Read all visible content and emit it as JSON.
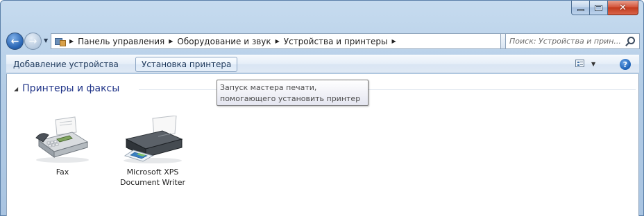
{
  "window": {
    "minimize_icon": "minimize-icon",
    "maximize_icon": "maximize-icon",
    "close_icon": "close-icon",
    "close_glyph": "✕"
  },
  "navigation": {
    "back_icon": "back-arrow-icon",
    "forward_icon": "forward-arrow-icon",
    "back_glyph": "←",
    "forward_glyph": "→",
    "recent_glyph": "▼",
    "breadcrumb": [
      "Панель управления",
      "Оборудование и звук",
      "Устройства и принтеры"
    ],
    "separator": "▶",
    "dropdown_glyph": "▼",
    "refresh_glyph": "↻"
  },
  "search": {
    "placeholder": "Поиск: Устройства и прин..."
  },
  "commands": {
    "add_device": "Добавление устройства",
    "install_printer": "Установка принтера",
    "view_dropdown_glyph": "▼",
    "help_glyph": "?"
  },
  "group": {
    "toggle_glyph": "◢",
    "title": "Принтеры и факсы"
  },
  "tooltip": {
    "line1": "Запуск мастера печати,",
    "line2": "помогающего установить принтер"
  },
  "devices": [
    {
      "name_line1": "Fax",
      "name_line2": "",
      "icon": "fax-icon"
    },
    {
      "name_line1": "Microsoft XPS",
      "name_line2": "Document Writer",
      "icon": "printer-icon"
    }
  ],
  "colors": {
    "frame": "#b4cde6",
    "accent_text": "#1e3287",
    "command_text": "#1e395b",
    "close_button": "#c23a1d"
  }
}
